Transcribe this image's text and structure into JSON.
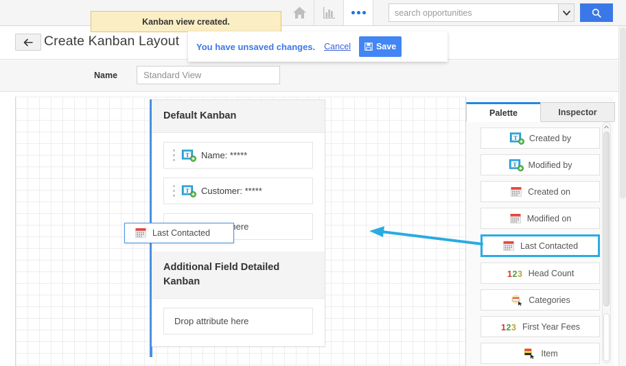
{
  "topbar": {
    "home_icon": "home-icon",
    "chart_icon": "bar-chart-icon",
    "more_icon": "more-dots-icon",
    "search": {
      "placeholder": "search opportunities",
      "value": "",
      "dropdown_icon": "chevron-down-icon",
      "submit_icon": "search-icon"
    }
  },
  "notice": {
    "message": "Kanban view created."
  },
  "unsaved_bar": {
    "message": "You have unsaved changes.",
    "cancel_label": "Cancel",
    "save_label": "Save",
    "save_icon": "floppy-disk-icon"
  },
  "header": {
    "back_icon": "arrow-left-icon",
    "title": "Create Kanban Layout"
  },
  "form": {
    "name_label": "Name",
    "name_placeholder": "Standard View",
    "name_value": ""
  },
  "canvas": {
    "sections": [
      {
        "title": "Default Kanban",
        "cards": [
          {
            "icon": "text-attribute-icon",
            "label": "Name: *****"
          },
          {
            "icon": "text-attribute-icon",
            "label": "Customer: *****"
          }
        ],
        "dropzone_label": "Drop attribute here"
      },
      {
        "title": "Additional Field Detailed Kanban",
        "cards": [],
        "dropzone_label": "Drop attribute here"
      }
    ],
    "drag_ghost": {
      "icon": "calendar-icon",
      "label": "Last Contacted"
    },
    "annotation_arrow": "arrow-left-pointer"
  },
  "right_panel": {
    "tabs": [
      {
        "label": "Palette",
        "active": true
      },
      {
        "label": "Inspector",
        "active": false
      }
    ],
    "items": [
      {
        "icon": "text-attribute-icon",
        "label": "Created by",
        "selected": false
      },
      {
        "icon": "text-attribute-icon",
        "label": "Modified by",
        "selected": false
      },
      {
        "icon": "calendar-icon",
        "label": "Created on",
        "selected": false
      },
      {
        "icon": "calendar-icon",
        "label": "Modified on",
        "selected": false
      },
      {
        "icon": "calendar-icon",
        "label": "Last Contacted",
        "selected": true
      },
      {
        "icon": "number-123-icon",
        "label": "Head Count",
        "selected": false
      },
      {
        "icon": "category-icon",
        "label": "Categories",
        "selected": false
      },
      {
        "icon": "number-123-icon",
        "label": "First Year Fees",
        "selected": false
      },
      {
        "icon": "item-icon",
        "label": "Item",
        "selected": false
      }
    ]
  },
  "colors": {
    "accent_blue": "#4a90e2",
    "primary_button": "#4285f4",
    "notice_bg": "#fbeec4",
    "notice_border": "#e0c56e",
    "selection_blue": "#29abe2",
    "tab_active_border": "#1e88e5"
  }
}
